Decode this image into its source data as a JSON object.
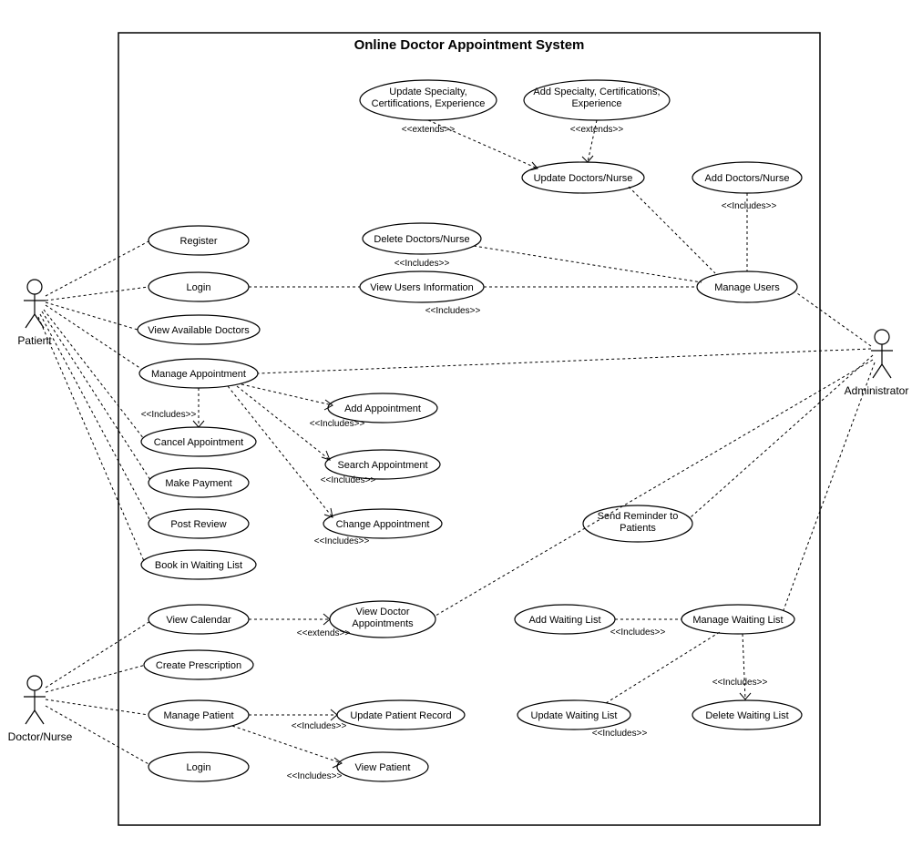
{
  "title": "Online Doctor Appointment System",
  "actors": {
    "patient": "Patient",
    "doctor": "Doctor/Nurse",
    "admin": "Administrator"
  },
  "usecases": {
    "update_spec": "Update Specialty, Certifications, Experience",
    "add_spec": "Add Specialty, Certifications, Experience",
    "update_dn": "Update Doctors/Nurse",
    "add_dn": "Add Doctors/Nurse",
    "delete_dn": "Delete Doctors/Nurse",
    "view_users": "View Users Information",
    "manage_users": "Manage Users",
    "register": "Register",
    "login1": "Login",
    "view_avail": "View Available Doctors",
    "manage_appt": "Manage Appointment",
    "add_appt": "Add Appointment",
    "cancel_appt": "Cancel Appointment",
    "search_appt": "Search Appointment",
    "make_pay": "Make Payment",
    "post_review": "Post Review",
    "change_appt": "Change Appointment",
    "send_rem": "Send Reminder to Patients",
    "book_wait": "Book in Waiting List",
    "view_cal": "View Calendar",
    "view_doc_appt": "View Doctor Appointments",
    "add_wait": "Add Waiting List",
    "manage_wait": "Manage Waiting List",
    "create_rx": "Create Prescription",
    "manage_patient": "Manage Patient",
    "update_prec": "Update Patient Record",
    "update_wait": "Update Waiting List",
    "delete_wait": "Delete Waiting List",
    "login2": "Login",
    "view_patient": "View Patient"
  },
  "stereotypes": {
    "extends": "<<extends>>",
    "includes": "<<Includes>>"
  }
}
